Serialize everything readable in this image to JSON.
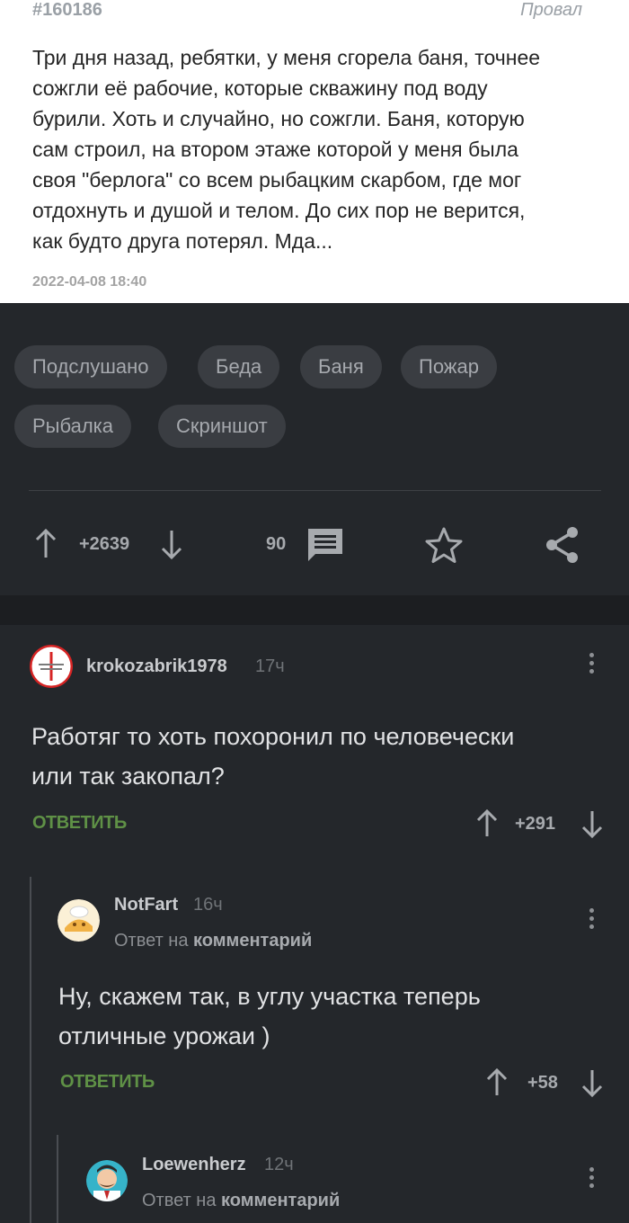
{
  "story": {
    "id": "#160186",
    "tag": "Провал",
    "text": "Три дня назад, ребятки, у меня сгорела баня, точнее\nсожгли её рабочие, которые скважину под воду\nбурили. Хоть и случайно, но сожгли. Баня, которую\nсам строил, на втором этаже которой у меня была\nсвоя \"берлога\" со всем рыбацким скарбом, где мог\nотдохнуть и душой и телом. До сих пор не верится,\nкак будто друга потерял. Мда...",
    "date": "2022-04-08 18:40"
  },
  "tags": [
    "Подслушано",
    "Беда",
    "Баня",
    "Пожар",
    "Рыбалка",
    "Скриншот"
  ],
  "actions": {
    "rating": "+2639",
    "comments_count": "90"
  },
  "comments": [
    {
      "username": "krokozabrik1978",
      "time": "17ч",
      "text": "Работяг то хоть похоронил по человечески\nили так закопал?",
      "reply_label": "ОТВЕТИТЬ",
      "rating": "+291"
    },
    {
      "username": "NotFart",
      "time": "16ч",
      "reply_to_prefix": "Ответ на",
      "reply_to_target": "комментарий",
      "text": "Ну, скажем так, в углу участка теперь\nотличные урожаи )",
      "reply_label": "ОТВЕТИТЬ",
      "rating": "+58"
    },
    {
      "username": "Loewenherz",
      "time": "12ч",
      "reply_to_prefix": "Ответ на",
      "reply_to_target": "комментарий"
    }
  ],
  "colors": {
    "background": "#24272b",
    "card": "#ffffff",
    "accent_green": "#5f9146",
    "tag_bg": "#3a3d42"
  }
}
